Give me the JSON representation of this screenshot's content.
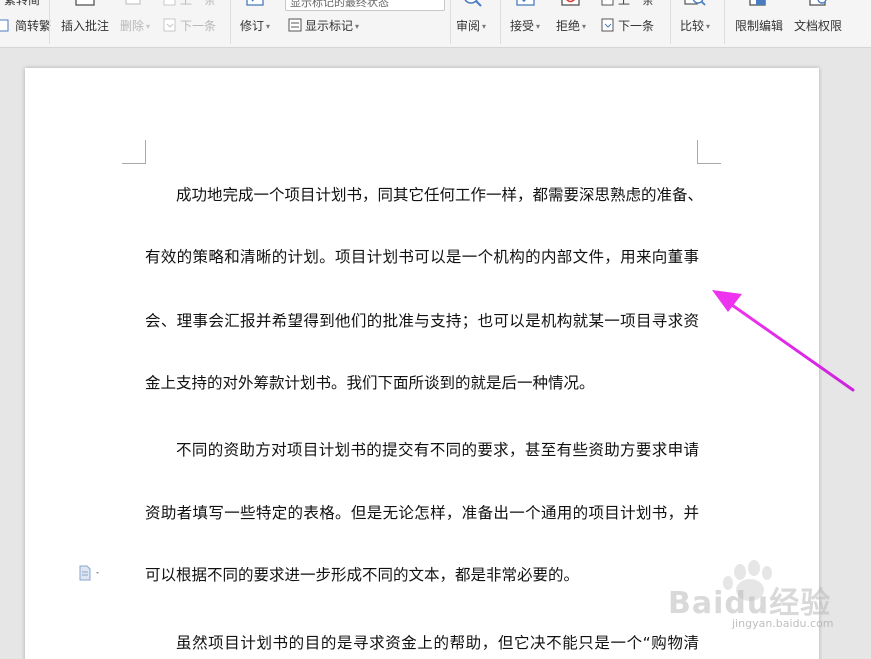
{
  "ribbon": {
    "trad_to_simp_label": "繁转简",
    "simp_to_trad_label": "简转繁",
    "insert_comment_label": "插入批注",
    "delete_label": "删除",
    "prev_label": "上一条",
    "next_label": "下一条",
    "track_changes_label": "修订",
    "markup_state_combo": "显示标记的最终状态",
    "show_markup_label": "显示标记",
    "review_label": "审阅",
    "accept_label": "接受",
    "reject_label": "拒绝",
    "prev2_label": "上一条",
    "next2_label": "下一条",
    "compare_label": "比较",
    "restrict_edit_label": "限制编辑",
    "doc_permission_label": "文档权限"
  },
  "document": {
    "lines": [
      "成功地完成一个项目计划书，同其它任何工作一样，都需要深思熟虑的准备、",
      "有效的策略和清晰的计划。项目计划书可以是一个机构的内部文件，用来向董事",
      "会、理事会汇报并希望得到他们的批准与支持；也可以是机构就某一项目寻求资",
      "金上支持的对外筹款计划书。我们下面所谈到的就是后一种情况。",
      "不同的资助方对项目计划书的提交有不同的要求，甚至有些资助方要求申请",
      "资助者填写一些特定的表格。但是无论怎样，准备出一个通用的项目计划书，并",
      "可以根据不同的要求进一步形成不同的文本，都是非常必要的。",
      "虽然项目计划书的目的是寻求资金上的帮助，但它决不能只是一个“购物清"
    ]
  },
  "watermark": {
    "brand": "Baidu经验",
    "url": "jingyan.baidu.com"
  },
  "colors": {
    "arrow": "#ee33ee",
    "ribbon_bg": "#f5f5f5",
    "canvas_bg": "#e6e6e6"
  }
}
